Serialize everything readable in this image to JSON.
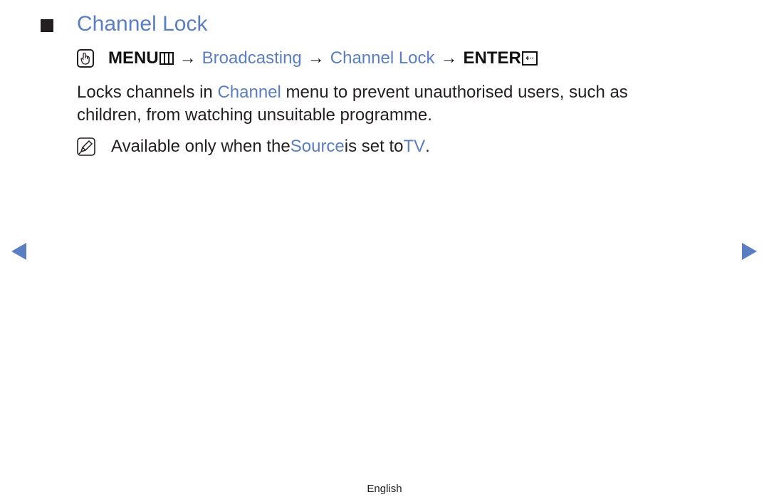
{
  "section": {
    "title": "Channel Lock"
  },
  "menu_path": {
    "items": [
      {
        "label": "MENU",
        "style": "bold"
      },
      {
        "label": "Broadcasting",
        "style": "link"
      },
      {
        "label": "Channel Lock",
        "style": "link"
      },
      {
        "label": "ENTER",
        "style": "bold"
      }
    ],
    "arrow": "→",
    "enter_symbol": "⇠"
  },
  "description": {
    "part1": "Locks channels in ",
    "highlight": "Channel",
    "part2": " menu to prevent unauthorised users, such as children, from watching unsuitable programme."
  },
  "note": {
    "part1": "Available only when the ",
    "highlight1": "Source",
    "part2": " is set to ",
    "highlight2": "TV",
    "part3": "."
  },
  "navigation": {
    "prev_icon": "triangle-left-icon",
    "next_icon": "triangle-right-icon"
  },
  "footer": {
    "language": "English"
  },
  "colors": {
    "accent": "#5a7ec3",
    "text": "#231f20"
  }
}
